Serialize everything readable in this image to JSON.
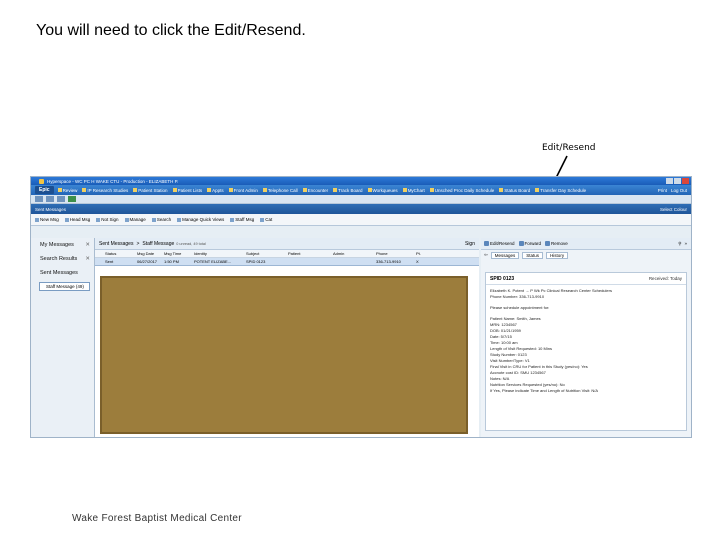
{
  "slide": {
    "title": "You will need to click the Edit/Resend.",
    "callout": "Edit/Resend",
    "footer": "Wake Forest Baptist Medical Center"
  },
  "app": {
    "window_title": "Hyperspace - WC PC H WAKE CTU - Production - ELIZABETH P.",
    "menu_button": "Epic",
    "menu_items": [
      "Review",
      "IP Research Studies",
      "Patient Station",
      "Patient Lists",
      "Appts",
      "Front Admin",
      "Telephone Call",
      "Encounter",
      "Track Board",
      "Workqueues",
      "MyChart",
      "Unsched Proc Daily Schedule",
      "Status Board",
      "Transfer Day Schedule"
    ],
    "menu_right": [
      "Print",
      "Log Out"
    ],
    "activity_title": "Sent Messages",
    "activity_right": "Select Colour",
    "toolbar_items": [
      "New Msg",
      "Head Msg",
      "Not Sign",
      "Manage",
      "Search",
      "Manage Quick Views",
      "Staff Msg",
      "Cat"
    ],
    "colors": {
      "accent": "#2264b5",
      "redacted": "#9c7d3c"
    }
  },
  "nav": {
    "items": [
      "My Messages",
      "Search Results",
      "Sent Messages"
    ],
    "sub_item": "Staff Message (49)"
  },
  "list": {
    "breadcrumb_root": "Sent Messages",
    "breadcrumb_current": "Staff Message",
    "breadcrumb_note": "0 unread, 49 total",
    "sign_label": "Sign",
    "columns": [
      "Status",
      "Msg Date",
      "Msg Time",
      "Identity",
      "Subject",
      "Patient",
      "Admin",
      "Phone",
      "Pt.",
      ""
    ],
    "row": [
      "Sent",
      "06/27/2017",
      "1:50 PM",
      "POTENT ELIZABE...",
      "SPID 0123",
      "",
      "",
      "336-713-9910",
      "X",
      ""
    ]
  },
  "reader": {
    "edit_resend": "Edit/Resend",
    "toolbar": [
      "Edit/Resend",
      "Forward",
      "Remove"
    ],
    "tabs": [
      "Messages",
      "Status",
      "History"
    ],
    "title": "SPID 0123",
    "received": "Received: Today",
    "body": [
      "Elizabeth K. Potent → P Wk Pc Clinical Research Center Schedulers",
      "Phone Number: 336-713-9910",
      "",
      "Please schedule appointment for:",
      "",
      "Patient Name: Smith, James",
      "MRN: 1234567",
      "DOB: 01/21/1959",
      "Date: 5/7/15",
      "Time: 10:00 am",
      "Length of Visit Requested: 10 Mins",
      "Study Number: 0123",
      "Visit Number/Type: V1",
      "Final Visit in CRU for Patient in this Study (yes/no): Yes",
      "Accnote cost ID: SMU 1234567",
      "Notes: N/A",
      "Nutrition Services Requested (yes/no): No",
      "If Yes, Please indicate Time and Length of Nutrition Visit: N/A"
    ]
  }
}
